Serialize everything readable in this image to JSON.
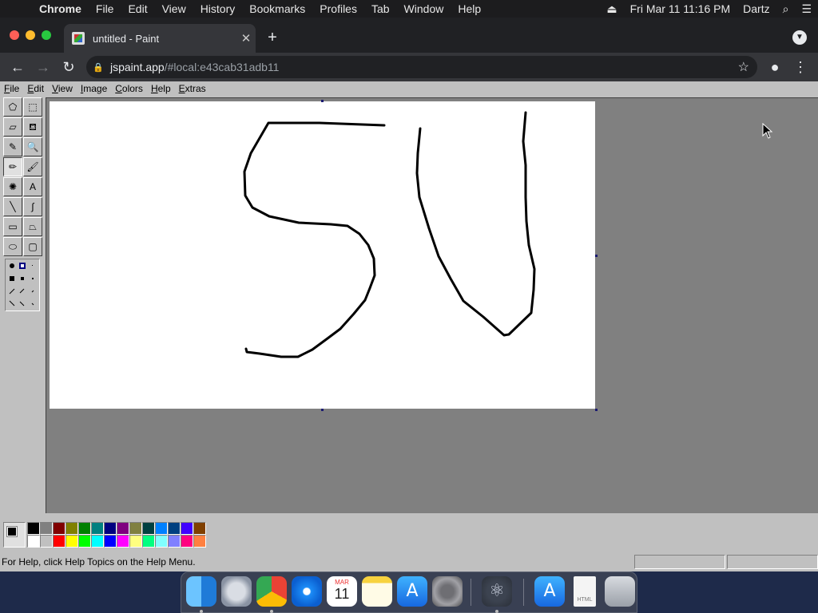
{
  "menubar": {
    "app_name": "Chrome",
    "items": [
      "File",
      "Edit",
      "View",
      "History",
      "Bookmarks",
      "Profiles",
      "Tab",
      "Window",
      "Help"
    ],
    "datetime": "Fri Mar 11  11:16 PM",
    "user": "Dartz"
  },
  "browser": {
    "tab_title": "untitled - Paint",
    "url_host": "jspaint.app",
    "url_path": "/#local:e43cab31adb11"
  },
  "paint": {
    "menu": [
      "File",
      "Edit",
      "View",
      "Image",
      "Colors",
      "Help",
      "Extras"
    ],
    "tools": [
      {
        "name": "free-form-select",
        "glyph": "⬠"
      },
      {
        "name": "select",
        "glyph": "⬚"
      },
      {
        "name": "eraser",
        "glyph": "▱"
      },
      {
        "name": "fill",
        "glyph": "⛾"
      },
      {
        "name": "pick-color",
        "glyph": "✎"
      },
      {
        "name": "magnifier",
        "glyph": "🔍"
      },
      {
        "name": "pencil",
        "glyph": "✏"
      },
      {
        "name": "brush",
        "glyph": "🖌"
      },
      {
        "name": "airbrush",
        "glyph": "✺"
      },
      {
        "name": "text",
        "glyph": "A"
      },
      {
        "name": "line",
        "glyph": "╲"
      },
      {
        "name": "curve",
        "glyph": "∫"
      },
      {
        "name": "rectangle",
        "glyph": "▭"
      },
      {
        "name": "polygon",
        "glyph": "⏢"
      },
      {
        "name": "ellipse",
        "glyph": "⬭"
      },
      {
        "name": "rounded-rectangle",
        "glyph": "▢"
      }
    ],
    "active_tool": "pencil",
    "palette": [
      "#000000",
      "#808080",
      "#800000",
      "#808000",
      "#008000",
      "#008080",
      "#000080",
      "#800080",
      "#808040",
      "#004040",
      "#0080ff",
      "#004080",
      "#4000ff",
      "#804000",
      "#ffffff",
      "#c0c0c0",
      "#ff0000",
      "#ffff00",
      "#00ff00",
      "#00ffff",
      "#0000ff",
      "#ff00ff",
      "#ffff80",
      "#00ff80",
      "#80ffff",
      "#8080ff",
      "#ff0080",
      "#ff8040"
    ],
    "foreground": "#000000",
    "background": "#ffffff",
    "status_text": "For Help, click Help Topics on the Help Menu."
  },
  "dock": {
    "apps": [
      "finder",
      "launchpad",
      "chrome",
      "safari",
      "calendar",
      "notes",
      "app-store",
      "system-preferences",
      "atom",
      "app-store-download",
      "html-file",
      "trash"
    ],
    "calendar_month": "MAR",
    "calendar_day": "11"
  }
}
